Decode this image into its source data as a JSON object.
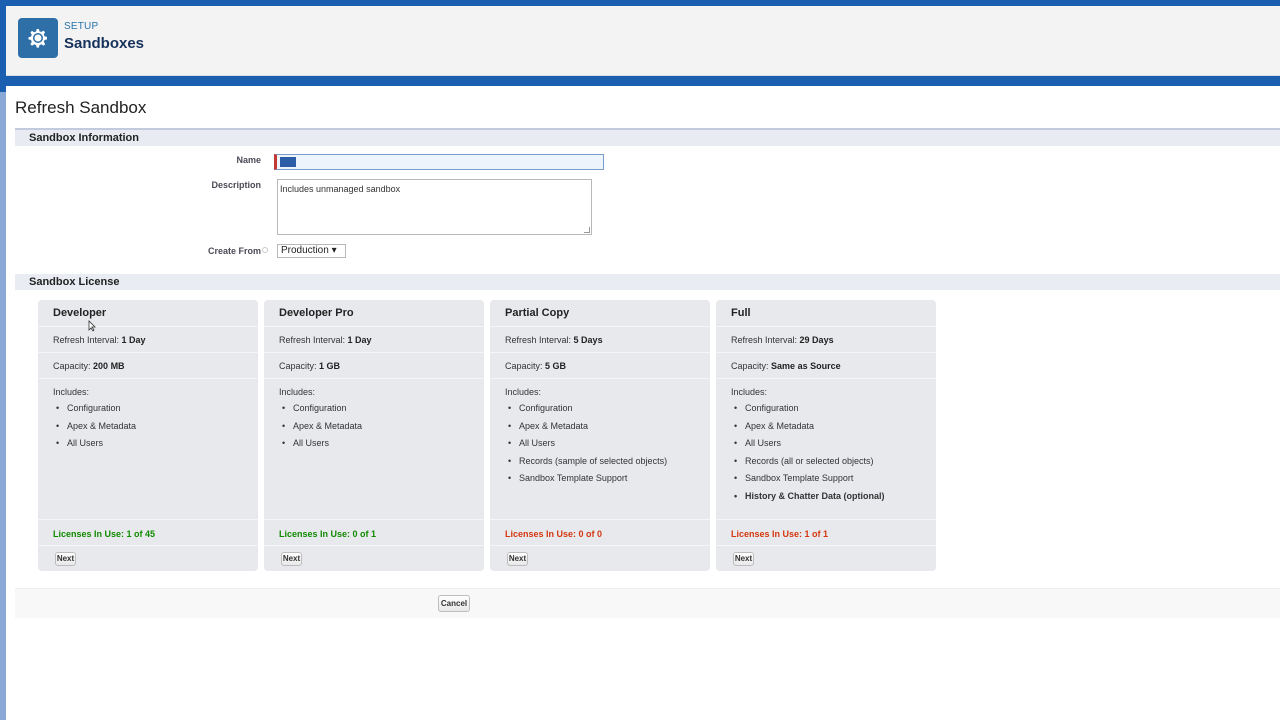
{
  "header": {
    "breadcrumb": "SETUP",
    "title": "Sandboxes",
    "icon": "gear-icon"
  },
  "page": {
    "title": "Refresh Sandbox"
  },
  "sandbox_info": {
    "section_label": "Sandbox Information",
    "name_label": "Name",
    "name_value": "test",
    "description_label": "Description",
    "description_value": "Includes unmanaged sandbox",
    "create_from_label": "Create From",
    "create_from_value": "Production ▾"
  },
  "license_section": {
    "section_label": "Sandbox License",
    "cards": [
      {
        "title": "Developer",
        "refresh_label": "Refresh Interval:",
        "refresh_value": "1 Day",
        "capacity_label": "Capacity:",
        "capacity_value": "200 MB",
        "includes_label": "Includes:",
        "includes": [
          "Configuration",
          "Apex & Metadata",
          "All Users"
        ],
        "licenses": "Licenses In Use: 1 of 45",
        "licenses_color": "green",
        "next_label": "Next"
      },
      {
        "title": "Developer Pro",
        "refresh_label": "Refresh Interval:",
        "refresh_value": "1 Day",
        "capacity_label": "Capacity:",
        "capacity_value": "1 GB",
        "includes_label": "Includes:",
        "includes": [
          "Configuration",
          "Apex & Metadata",
          "All Users"
        ],
        "licenses": "Licenses In Use: 0 of 1",
        "licenses_color": "green",
        "next_label": "Next"
      },
      {
        "title": "Partial Copy",
        "refresh_label": "Refresh Interval:",
        "refresh_value": "5 Days",
        "capacity_label": "Capacity:",
        "capacity_value": "5 GB",
        "includes_label": "Includes:",
        "includes": [
          "Configuration",
          "Apex & Metadata",
          "All Users",
          "Records (sample of selected objects)",
          "Sandbox Template Support"
        ],
        "licenses": "Licenses In Use: 0 of 0",
        "licenses_color": "red",
        "next_label": "Next"
      },
      {
        "title": "Full",
        "refresh_label": "Refresh Interval:",
        "refresh_value": "29 Days",
        "capacity_label": "Capacity:",
        "capacity_value": "Same as Source",
        "includes_label": "Includes:",
        "includes": [
          "Configuration",
          "Apex & Metadata",
          "All Users",
          "Records (all or selected objects)",
          "Sandbox Template Support",
          "History & Chatter Data (optional)"
        ],
        "licenses": "Licenses In Use: 1 of 1",
        "licenses_color": "red",
        "next_label": "Next"
      }
    ]
  },
  "footer": {
    "cancel_label": "Cancel"
  },
  "colors": {
    "accent": "#1b5fb0",
    "green": "#108a00",
    "red": "#d4370f"
  }
}
